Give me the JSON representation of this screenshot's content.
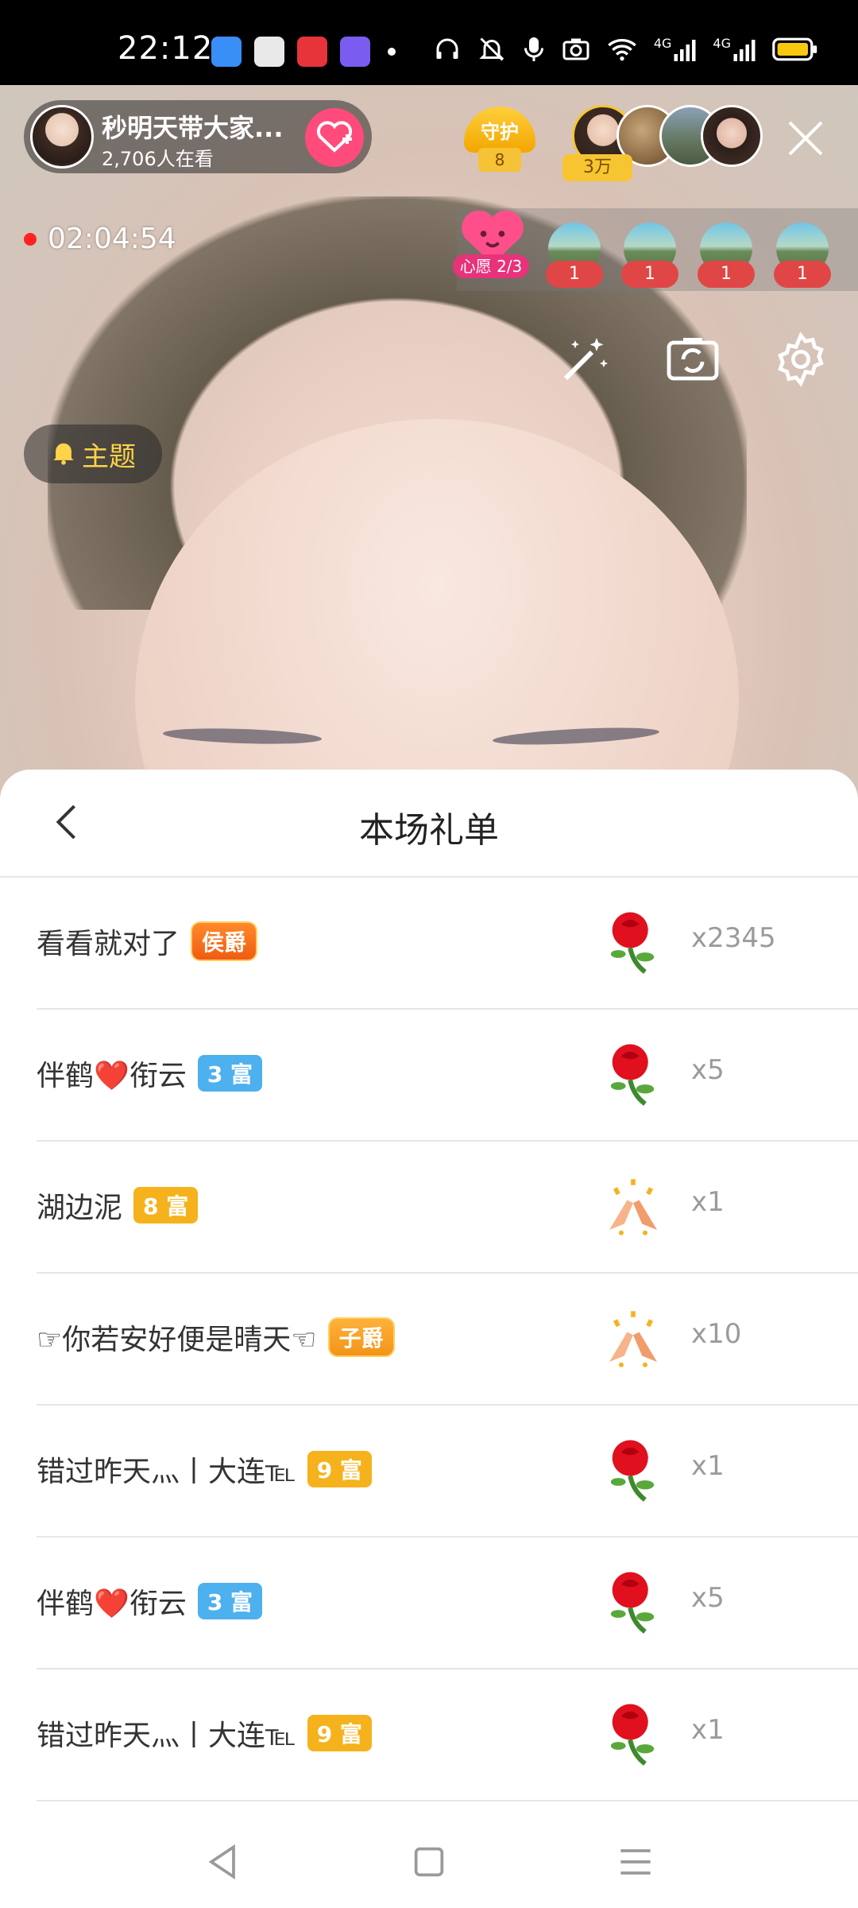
{
  "status_bar": {
    "time": "22:12",
    "network_label_1": "4G",
    "network_label_2": "4G",
    "app_icons": [
      "browser-icon",
      "app-icon",
      "video-icon",
      "editor-icon"
    ]
  },
  "live": {
    "streamer_name": "秒明天带大家...",
    "viewers": "2,706人在看",
    "guard_label": "守护",
    "guard_count": "8",
    "contribution": "3万",
    "record_time": "02:04:54",
    "wish_label": "心愿 2/3",
    "wish_counts": [
      "1",
      "1",
      "1",
      "1"
    ],
    "theme_label": "主题"
  },
  "sheet": {
    "title": "本场礼单",
    "rows": [
      {
        "name": "看看就对了",
        "badge": "侯爵",
        "badge_type": "noble",
        "gift": "rose",
        "qty": "x2345"
      },
      {
        "name": "伴鹤❤️衔云",
        "badge": "3 富",
        "badge_type": "blue",
        "gift": "rose",
        "qty": "x5"
      },
      {
        "name": "湖边泥",
        "badge": "8 富",
        "badge_type": "gold",
        "gift": "clap",
        "qty": "x1"
      },
      {
        "name": "☞你若安好便是晴天☜",
        "badge": "子爵",
        "badge_type": "noble-z",
        "gift": "clap",
        "qty": "x10"
      },
      {
        "name": "错过昨天灬丨大连℡",
        "badge": "9 富",
        "badge_type": "gold",
        "gift": "rose",
        "qty": "x1"
      },
      {
        "name": "伴鹤❤️衔云",
        "badge": "3 富",
        "badge_type": "blue",
        "gift": "rose",
        "qty": "x5"
      },
      {
        "name": "错过昨天灬丨大连℡",
        "badge": "9 富",
        "badge_type": "gold",
        "gift": "rose",
        "qty": "x1"
      }
    ]
  },
  "colors": {
    "accent_pink": "#ff4b7c",
    "badge_blue": "#4db0ef",
    "badge_gold": "#f6b21c",
    "noble_orange": "#f05c12",
    "record_red": "#ff2222"
  }
}
